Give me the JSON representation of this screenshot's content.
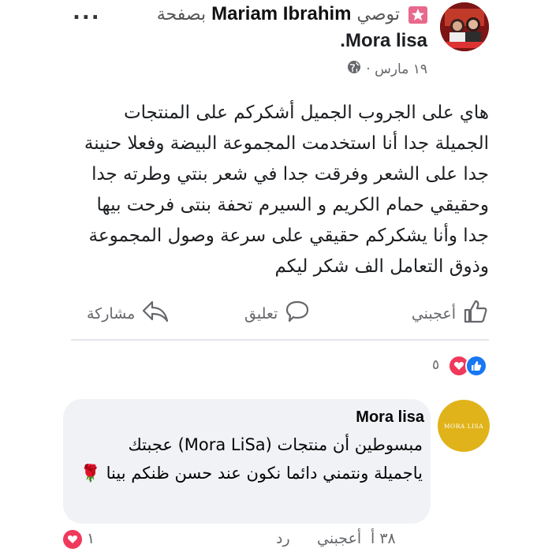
{
  "post": {
    "more_label": "...",
    "recommends_label": "توصي",
    "author": "Mariam Ibrahim",
    "on_page_label": "بصفحة",
    "page_name": "Mora lisa",
    "period": ".",
    "date": "١٩ مارس ·",
    "text": "هاي على الجروب الجميل أشكركم على المنتجات الجميلة جدا أنا استخدمت المجموعة البيضة وفعلا حنينة جدا على الشعر وفرقت جدا في شعر بنتي وطرته جدا وحقيقي حمام الكريم و السيرم تحفة بنتى فرحت بيها جدا وأنا يشكركم حقيقي على سرعة وصول المجموعة وذوق التعامل الف شكر ليكم"
  },
  "actions": {
    "like": "أعجبني",
    "comment": "تعليق",
    "share": "مشاركة"
  },
  "reactions": {
    "count": "٥"
  },
  "comment": {
    "author": "Mora lisa",
    "avatar_text": "MORA LISA",
    "text": "مبسوطين أن منتجات (Mora LiSa) عجبتك ياجميلة ونتمني دائما نكون عند حسن ظنكم بينا 🌹",
    "like": "أعجبني",
    "reply": "رد",
    "time": "٣٨ أ",
    "react_count": "١"
  },
  "colors": {
    "accent": "#1877f2",
    "love": "#f0395b",
    "badge": "#e8698c",
    "gold": "#e0b31a"
  }
}
